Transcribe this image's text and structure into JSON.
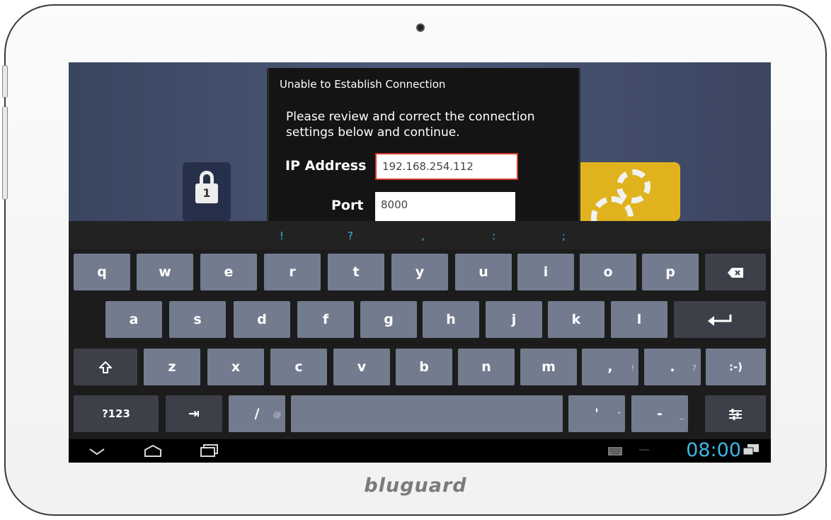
{
  "device": {
    "brand": "bluguard"
  },
  "dialog": {
    "title": "Unable to Establish Connection",
    "message": "Please review and correct the connection settings below and continue.",
    "ip_label": "IP Address",
    "ip_value": "192.168.254.112",
    "port_label": "Port",
    "port_value": "8000"
  },
  "background": {
    "lock_badge": "1"
  },
  "keyboard": {
    "suggestions": [
      "!",
      "?",
      ",",
      ":",
      ";"
    ],
    "row1": [
      "q",
      "w",
      "e",
      "r",
      "t",
      "y",
      "u",
      "i",
      "o",
      "p"
    ],
    "row2": [
      "a",
      "s",
      "d",
      "f",
      "g",
      "h",
      "j",
      "k",
      "l"
    ],
    "row3": [
      "z",
      "x",
      "c",
      "v",
      "b",
      "n",
      "m"
    ],
    "comma_key": ",",
    "comma_hint": "!",
    "period_key": ".",
    "period_hint": "?",
    "smiley_key": ":-)",
    "symbols_key": "?123",
    "tab_key": "⇥",
    "slash_key": "/",
    "slash_hint": "@",
    "apostrophe_key": "'",
    "apostrophe_hint": "\"",
    "dash_key": "-",
    "dash_hint": "_"
  },
  "status_bar": {
    "time": "08:00"
  },
  "colors": {
    "accent": "#3fb6e6",
    "key": "#737b8e",
    "gear_tile": "#e0b31e",
    "error_border": "#d63a2e"
  }
}
